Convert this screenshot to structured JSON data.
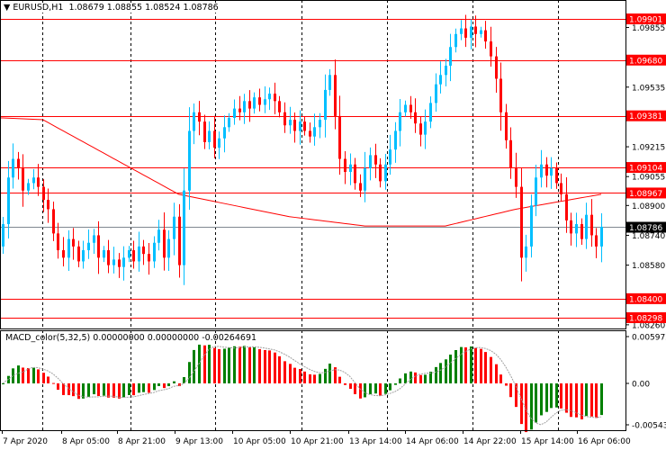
{
  "header": {
    "symbol": "EURUSD,H1",
    "open": "1.08679",
    "high": "1.08855",
    "low": "1.08524",
    "close": "1.08786"
  },
  "macd_header": {
    "name": "MACD_color(5,32,5)",
    "v1": "0.00000000",
    "v2": "0.00000000",
    "v3": "-0.00264691"
  },
  "colors": {
    "bull": "#00bfff",
    "bear": "#ff0000",
    "level": "#ff0000",
    "bid": "#808890",
    "ma": "#ff0000",
    "macd_up": "#008000",
    "macd_down": "#ff0000",
    "signal": "#a0a0a0"
  },
  "chart_data": [
    {
      "type": "candlestick",
      "title": "EURUSD,H1",
      "ylim": [
        1.0826,
        1.0997
      ],
      "price_ticks": [
        "1.09855",
        "1.09535",
        "1.09215",
        "1.09055",
        "1.08900",
        "1.08740",
        "1.08580",
        "1.08260"
      ],
      "levels": [
        "1.09901",
        "1.09680",
        "1.09381",
        "1.09104",
        "1.08967",
        "1.08400",
        "1.08298"
      ],
      "current_price": "1.08786",
      "x_labels": [
        "7 Apr 2020",
        "8 Apr 05:00",
        "8 Apr 21:00",
        "9 Apr 13:00",
        "10 Apr 05:00",
        "10 Apr 21:00",
        "13 Apr 14:00",
        "14 Apr 06:00",
        "14 Apr 22:00",
        "15 Apr 14:00",
        "16 Apr 06:00"
      ],
      "closes": [
        1.088,
        1.0905,
        1.0915,
        1.091,
        1.0898,
        1.0902,
        1.0905,
        1.09,
        1.0893,
        1.0888,
        1.0875,
        1.0866,
        1.0862,
        1.0872,
        1.0868,
        1.086,
        1.0866,
        1.087,
        1.0874,
        1.0862,
        1.0866,
        1.0858,
        1.0861,
        1.0857,
        1.0862,
        1.0866,
        1.086,
        1.0868,
        1.0864,
        1.086,
        1.087,
        1.0877,
        1.0862,
        1.0872,
        1.0884,
        1.0858,
        1.0898,
        1.093,
        1.094,
        1.0935,
        1.0924,
        1.093,
        1.0921,
        1.0926,
        1.0932,
        1.0937,
        1.0942,
        1.094,
        1.0946,
        1.0942,
        1.0948,
        1.0944,
        1.0947,
        1.095,
        1.0946,
        1.094,
        1.0933,
        1.0936,
        1.093,
        1.0935,
        1.093,
        1.0927,
        1.0932,
        1.0936,
        1.0952,
        1.096,
        1.0938,
        1.0915,
        1.0908,
        1.0912,
        1.0902,
        1.0898,
        1.091,
        1.0917,
        1.0912,
        1.0903,
        1.0912,
        1.092,
        1.093,
        1.094,
        1.0944,
        1.094,
        1.0934,
        1.0928,
        1.0935,
        1.0945,
        1.0955,
        1.096,
        1.0965,
        1.0975,
        1.0982,
        1.0985,
        1.098,
        1.0986,
        1.0982,
        1.0984,
        1.0978,
        1.097,
        1.0958,
        1.094,
        1.0925,
        1.091,
        1.09,
        1.0862,
        1.0868,
        1.089,
        1.0905,
        1.0912,
        1.0906,
        1.091,
        1.0902,
        1.0896,
        1.0882,
        1.0875,
        1.088,
        1.0872,
        1.0885,
        1.0874,
        1.0868,
        1.08786
      ],
      "first_open": 1.0868,
      "moving_average": [
        [
          0,
          1.0937
        ],
        [
          8,
          1.0936
        ],
        [
          35,
          1.0896
        ],
        [
          57,
          1.0884
        ],
        [
          72,
          1.0879
        ],
        [
          88,
          1.0879
        ],
        [
          102,
          1.0888
        ],
        [
          119,
          1.0896
        ]
      ]
    },
    {
      "type": "bar",
      "title": "MACD_color(5,32,5)",
      "ylim": [
        -0.0054321,
        0.005972
      ],
      "y_ticks": [
        "0.0059720",
        "0.00",
        "-0.005432"
      ],
      "fast": 5,
      "slow": 32,
      "signal": 5
    }
  ]
}
